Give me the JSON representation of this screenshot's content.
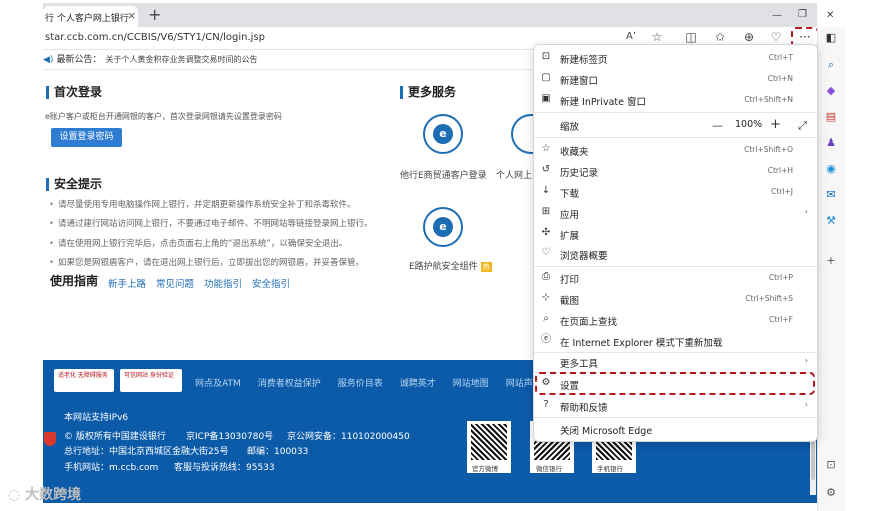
{
  "browser": {
    "tab_title": "行 个人客户网上银行",
    "tab_close": "×",
    "new_tab": "+",
    "url": "star.ccb.com.cn/CCBIS/V6/STY1/CN/login.jsp",
    "read_aloud": "Aʼ",
    "more_label": "···",
    "win_minimize": "—",
    "win_restore": "❐",
    "win_close": "✕"
  },
  "page": {
    "announcement_label": "最新公告：",
    "announcement_text": "关于个人黄金积存业务调整交易时间的公告",
    "first_login": {
      "title": "首次登录",
      "desc": "e账户客户或柜台开通网银的客户，首次登录网银请先设置登录密码",
      "button": "设置登录密码"
    },
    "more_services": {
      "title": "更多服务",
      "items": [
        {
          "label": "他行E商贸通客户登录",
          "glyph": "e"
        },
        {
          "label": "个人网上",
          "glyph": "e"
        },
        {
          "label": "E路护航安全组件",
          "glyph": "e",
          "badge": "热"
        }
      ]
    },
    "security": {
      "title": "安全提示",
      "tips": [
        "请尽量使用专用电脑操作网上银行，并定期更新操作系统安全补丁和杀毒软件。",
        "请通过建行网站访问网上银行，不要通过电子邮件、不明网站等链接登录网上银行。",
        "请在使用网上银行完毕后，点击页面右上角的“退出系统”，以确保安全退出。",
        "如果您是网银盾客户，请在退出网上银行后，立即拔出您的网银盾，并妥善保管。"
      ]
    },
    "guide": {
      "title": "使用指南",
      "links": [
        "新手上路",
        "常见问题",
        "功能指引",
        "安全指引"
      ]
    }
  },
  "footer": {
    "logo1": "适老化 无障碍服务",
    "logo2": "可信网站 身份验证",
    "nav": [
      "网点及ATM",
      "消费者权益保护",
      "服务价目表",
      "诚聘英才",
      "网站地图",
      "网站声明"
    ],
    "ipv6": "本网站支持IPv6",
    "copyright": "© 版权所有中国建设银行",
    "icp": "京ICP备13030780号",
    "police": "京公网安备：110102000450",
    "address": "总行地址：中国北京西城区金融大街25号",
    "zip": "邮编：100033",
    "mobile": "手机网站：m.ccb.com",
    "hotline": "客服与投诉热线：95533",
    "qr_labels": [
      "官方微博",
      "微信银行",
      "手机银行"
    ]
  },
  "menu": {
    "items": [
      {
        "id": "new-tab",
        "icon": "⊡",
        "label": "新建标签页",
        "shortcut": "Ctrl+T"
      },
      {
        "id": "new-window",
        "icon": "▢",
        "label": "新建窗口",
        "shortcut": "Ctrl+N"
      },
      {
        "id": "new-inprivate",
        "icon": "▣",
        "label": "新建 InPrivate 窗口",
        "shortcut": "Ctrl+Shift+N"
      },
      {
        "id": "zoom",
        "icon": "",
        "label": "缩放",
        "shortcut": ""
      },
      {
        "id": "favorites",
        "icon": "☆",
        "label": "收藏夹",
        "shortcut": "Ctrl+Shift+O"
      },
      {
        "id": "history",
        "icon": "↺",
        "label": "历史记录",
        "shortcut": "Ctrl+H"
      },
      {
        "id": "downloads",
        "icon": "↓",
        "label": "下载",
        "shortcut": "Ctrl+J"
      },
      {
        "id": "apps",
        "icon": "⊞",
        "label": "应用",
        "shortcut": "",
        "submenu": true
      },
      {
        "id": "extensions",
        "icon": "✣",
        "label": "扩展",
        "shortcut": ""
      },
      {
        "id": "browser-essentials",
        "icon": "♡",
        "label": "浏览器概要",
        "shortcut": ""
      },
      {
        "id": "print",
        "icon": "⎙",
        "label": "打印",
        "shortcut": "Ctrl+P"
      },
      {
        "id": "screenshot",
        "icon": "⊹",
        "label": "截图",
        "shortcut": "Ctrl+Shift+S"
      },
      {
        "id": "find",
        "icon": "⌕",
        "label": "在页面上查找",
        "shortcut": "Ctrl+F"
      },
      {
        "id": "ie-mode",
        "icon": "ⓔ",
        "label": "在 Internet Explorer 模式下重新加载",
        "shortcut": ""
      },
      {
        "id": "more-tools",
        "icon": "",
        "label": "更多工具",
        "shortcut": "",
        "submenu": true
      },
      {
        "id": "settings",
        "icon": "⚙",
        "label": "设置",
        "shortcut": ""
      },
      {
        "id": "help",
        "icon": "?",
        "label": "帮助和反馈",
        "shortcut": "",
        "submenu": true
      },
      {
        "id": "close-edge",
        "icon": "",
        "label": "关闭 Microsoft Edge",
        "shortcut": ""
      }
    ],
    "zoom_minus": "—",
    "zoom_value": "100%",
    "zoom_plus": "+",
    "zoom_fullscreen": "⤢",
    "submenu_arrow": "›"
  },
  "watermark": "大数跨境",
  "colors": {
    "ccb_blue": "#0c5ba9",
    "accent_blue": "#1d6db5",
    "highlight_red": "#b5181d"
  }
}
